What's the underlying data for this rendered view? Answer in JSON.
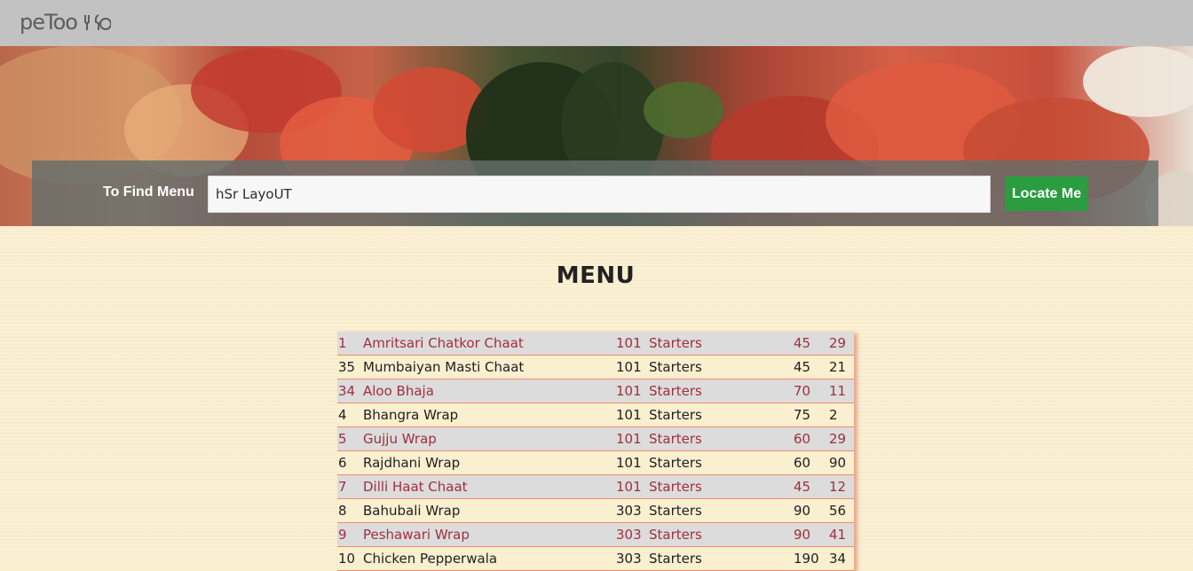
{
  "navbar": {
    "logo_text": "peToo",
    "logo_icon": "fork-knife-icon"
  },
  "search": {
    "label": "To Find Menu",
    "value": "hSr LayoUT",
    "button_label": "Locate Me"
  },
  "hero": {
    "image": "food-banner"
  },
  "menu": {
    "title": "MENU",
    "rows": [
      {
        "id": "1",
        "name": "Amritsari Chatkor Chaat",
        "code": "101",
        "category": "Starters",
        "price": "45",
        "qty": "29"
      },
      {
        "id": "35",
        "name": "Mumbaiyan Masti Chaat",
        "code": "101",
        "category": "Starters",
        "price": "45",
        "qty": "21"
      },
      {
        "id": "34",
        "name": "Aloo Bhaja",
        "code": "101",
        "category": "Starters",
        "price": "70",
        "qty": "11"
      },
      {
        "id": "4",
        "name": "Bhangra Wrap",
        "code": "101",
        "category": "Starters",
        "price": "75",
        "qty": "2"
      },
      {
        "id": "5",
        "name": "Gujju Wrap",
        "code": "101",
        "category": "Starters",
        "price": "60",
        "qty": "29"
      },
      {
        "id": "6",
        "name": "Rajdhani Wrap",
        "code": "101",
        "category": "Starters",
        "price": "60",
        "qty": "90"
      },
      {
        "id": "7",
        "name": "Dilli Haat Chaat",
        "code": "101",
        "category": "Starters",
        "price": "45",
        "qty": "12"
      },
      {
        "id": "8",
        "name": "Bahubali Wrap",
        "code": "303",
        "category": "Starters",
        "price": "90",
        "qty": "56"
      },
      {
        "id": "9",
        "name": "Peshawari Wrap",
        "code": "303",
        "category": "Starters",
        "price": "90",
        "qty": "41"
      },
      {
        "id": "10",
        "name": "Chicken Pepperwala",
        "code": "303",
        "category": "Starters",
        "price": "190",
        "qty": "34"
      }
    ]
  }
}
